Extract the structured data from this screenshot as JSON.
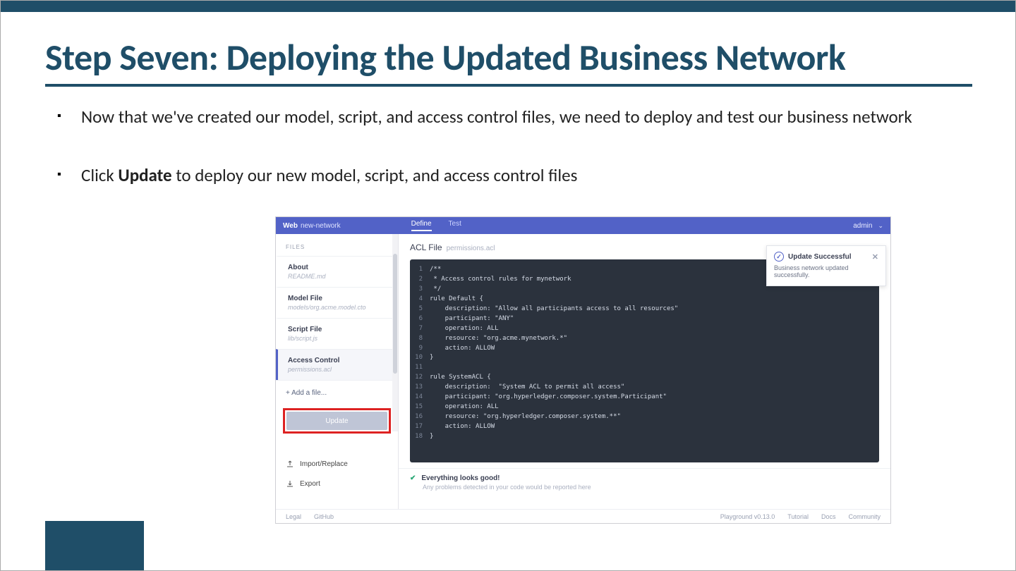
{
  "title": "Step Seven: Deploying the Updated Business Network",
  "bullets": {
    "b1": "Now that we've created our model, script, and access control files, we need to deploy and test our business network",
    "b2_pre": "Click ",
    "b2_bold": "Update",
    "b2_post": " to deploy our new model, script, and access control files"
  },
  "shot": {
    "topbar": {
      "brand": "Web",
      "network": "new-network",
      "tab_define": "Define",
      "tab_test": "Test",
      "admin": "admin"
    },
    "sidebar": {
      "files_label": "FILES",
      "items": [
        {
          "title": "About",
          "sub": "README.md"
        },
        {
          "title": "Model File",
          "sub": "models/org.acme.model.cto"
        },
        {
          "title": "Script File",
          "sub": "lib/script.js"
        },
        {
          "title": "Access Control",
          "sub": "permissions.acl"
        }
      ],
      "add_file": "+ Add a file...",
      "update": "Update",
      "import": "Import/Replace",
      "export": "Export"
    },
    "main": {
      "header_title": "ACL File",
      "header_sub": "permissions.acl",
      "code": [
        "/**",
        " * Access control rules for mynetwork",
        " */",
        "rule Default {",
        "    description: \"Allow all participants access to all resources\"",
        "    participant: \"ANY\"",
        "    operation: ALL",
        "    resource: \"org.acme.mynetwork.*\"",
        "    action: ALLOW",
        "}",
        "",
        "rule SystemACL {",
        "    description:  \"System ACL to permit all access\"",
        "    participant: \"org.hyperledger.composer.system.Participant\"",
        "    operation: ALL",
        "    resource: \"org.hyperledger.composer.system.**\"",
        "    action: ALLOW",
        "}"
      ],
      "status_title": "Everything looks good!",
      "status_sub": "Any problems detected in your code would be reported here"
    },
    "footer": {
      "legal": "Legal",
      "github": "GitHub",
      "version": "Playground v0.13.0",
      "tutorial": "Tutorial",
      "docs": "Docs",
      "community": "Community"
    },
    "toast": {
      "title": "Update Successful",
      "body": "Business network updated successfully."
    }
  }
}
